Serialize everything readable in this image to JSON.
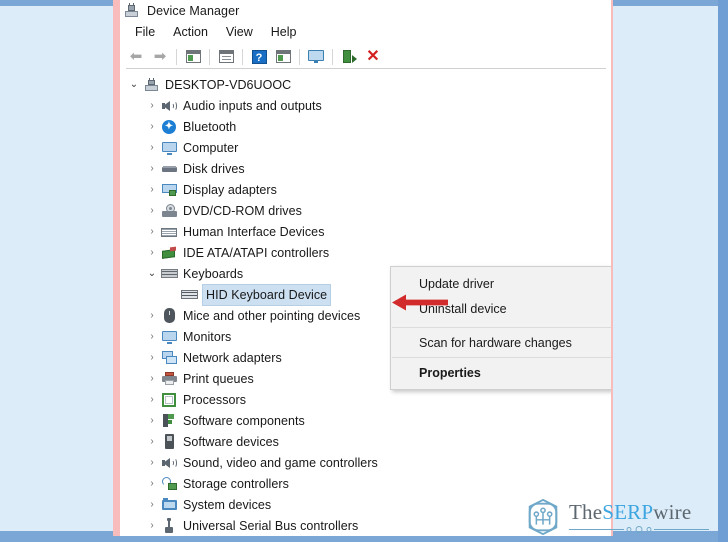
{
  "window": {
    "title": "Device Manager",
    "title_icon": "device-manager-icon"
  },
  "menubar": {
    "items": [
      {
        "label": "File"
      },
      {
        "label": "Action"
      },
      {
        "label": "View"
      },
      {
        "label": "Help"
      }
    ]
  },
  "toolbar": {
    "buttons": [
      {
        "name": "back-arrow-icon",
        "glyph": "←"
      },
      {
        "name": "forward-arrow-icon",
        "glyph": "→"
      },
      {
        "name": "show-hide-console-tree-icon",
        "glyph": ""
      },
      {
        "name": "properties-icon",
        "glyph": ""
      },
      {
        "name": "help-icon",
        "glyph": "?"
      },
      {
        "name": "update-driver-icon",
        "glyph": ""
      },
      {
        "name": "scan-for-hardware-changes-icon",
        "glyph": ""
      },
      {
        "name": "enable-device-icon",
        "glyph": ""
      },
      {
        "name": "uninstall-device-icon",
        "glyph": "✕"
      }
    ]
  },
  "tree": {
    "root": {
      "label": "DESKTOP-VD6UOOC",
      "icon": "computer-icon",
      "expanded": true
    },
    "nodes": [
      {
        "label": "Audio inputs and outputs",
        "icon": "speaker-icon",
        "expanded": false,
        "indent": 1
      },
      {
        "label": "Bluetooth",
        "icon": "bluetooth-icon",
        "expanded": false,
        "indent": 1
      },
      {
        "label": "Computer",
        "icon": "monitor-icon",
        "expanded": false,
        "indent": 1
      },
      {
        "label": "Disk drives",
        "icon": "disk-drive-icon",
        "expanded": false,
        "indent": 1
      },
      {
        "label": "Display adapters",
        "icon": "display-adapter-icon",
        "expanded": false,
        "indent": 1
      },
      {
        "label": "DVD/CD-ROM drives",
        "icon": "dvd-drive-icon",
        "expanded": false,
        "indent": 1
      },
      {
        "label": "Human Interface Devices",
        "icon": "hid-icon",
        "expanded": false,
        "indent": 1
      },
      {
        "label": "IDE ATA/ATAPI controllers",
        "icon": "ide-controller-icon",
        "expanded": false,
        "indent": 1
      },
      {
        "label": "Keyboards",
        "icon": "keyboard-icon",
        "expanded": true,
        "indent": 1
      },
      {
        "label": "HID Keyboard Device",
        "icon": "keyboard-device-icon",
        "expanded": null,
        "indent": 2,
        "selected": true
      },
      {
        "label": "Mice and other pointing devices",
        "icon": "mouse-icon",
        "expanded": false,
        "indent": 1
      },
      {
        "label": "Monitors",
        "icon": "monitor-icon",
        "expanded": false,
        "indent": 1
      },
      {
        "label": "Network adapters",
        "icon": "network-adapter-icon",
        "expanded": false,
        "indent": 1
      },
      {
        "label": "Print queues",
        "icon": "printer-icon",
        "expanded": false,
        "indent": 1
      },
      {
        "label": "Processors",
        "icon": "processor-icon",
        "expanded": false,
        "indent": 1
      },
      {
        "label": "Software components",
        "icon": "software-component-icon",
        "expanded": false,
        "indent": 1
      },
      {
        "label": "Software devices",
        "icon": "software-device-icon",
        "expanded": false,
        "indent": 1
      },
      {
        "label": "Sound, video and game controllers",
        "icon": "speaker-icon",
        "expanded": false,
        "indent": 1
      },
      {
        "label": "Storage controllers",
        "icon": "storage-controller-icon",
        "expanded": false,
        "indent": 1
      },
      {
        "label": "System devices",
        "icon": "system-device-icon",
        "expanded": false,
        "indent": 1
      },
      {
        "label": "Universal Serial Bus controllers",
        "icon": "usb-controller-icon",
        "expanded": false,
        "indent": 1
      }
    ],
    "chevron_collapsed": "›",
    "chevron_expanded": "⌄"
  },
  "context_menu": {
    "items": [
      {
        "label": "Update driver",
        "bold": false
      },
      {
        "label": "Uninstall device",
        "bold": false
      },
      {
        "separator": true
      },
      {
        "label": "Scan for hardware changes",
        "bold": false
      },
      {
        "separator": true
      },
      {
        "label": "Properties",
        "bold": true
      }
    ]
  },
  "annotation": {
    "arrow_color": "#d22b2b",
    "points_to": "Uninstall device"
  },
  "watermark": {
    "part1": "The",
    "part2": "SERP",
    "part3": "wire",
    "accent_color": "#3da5e0",
    "text_color": "#5c6770"
  },
  "colors": {
    "page_background": "#dcecf8",
    "frame_blue": "#7ba7d7",
    "accent_pink": "#f8bcbc",
    "window_background": "#ffffff",
    "selection": "#cde0f2",
    "menu_background": "#f2f2f2"
  }
}
